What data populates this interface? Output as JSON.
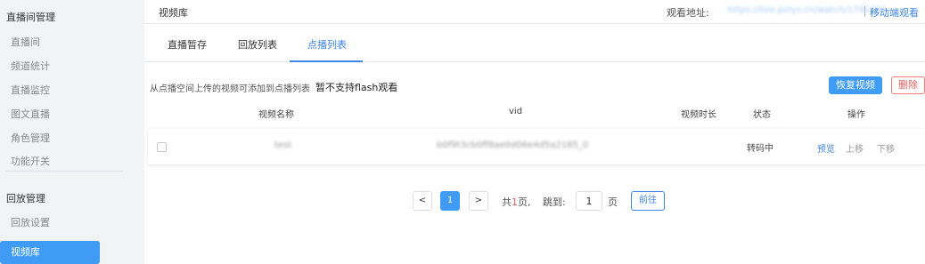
{
  "sidebar": {
    "group_live": "直播间管理",
    "items_live": [
      "直播间",
      "频道统计",
      "直播监控",
      "图文直播",
      "角色管理",
      "功能开关"
    ],
    "group_replay": "回放管理",
    "items_replay": [
      "回放设置"
    ],
    "active": "视频库"
  },
  "header": {
    "title": "视频库",
    "watch_label": "观看地址:",
    "watch_url": "https://live.polyv.cn/watch/1791661",
    "mobile_link": "移动端观看"
  },
  "tabs": [
    "直播暂存",
    "回放列表",
    "点播列表"
  ],
  "active_tab": "点播列表",
  "hint": {
    "text": "从点播空间上传的视频可添加到点播列表",
    "strong": "暂不支持flash观看"
  },
  "buttons": {
    "restore": "恢复视频",
    "delete": "删除"
  },
  "table": {
    "columns": [
      "视频名称",
      "vid",
      "视频时长",
      "状态",
      "操作"
    ],
    "rows": [
      {
        "name": "test",
        "vid": "b0f9t3cb0ff8ae0d06e4d5a2185_0",
        "duration": "",
        "status": "转码中",
        "actions": [
          "预览",
          "上移",
          "下移"
        ]
      }
    ]
  },
  "pagination": {
    "prev": "<",
    "current": "1",
    "next": ">",
    "total_prefix": "共",
    "total_pages": "1",
    "total_suffix": "页,",
    "jump_label": "跳到:",
    "jump_value": "1",
    "page_label": "页",
    "go": "前往"
  },
  "colors": {
    "accent": "#3f9bf4",
    "link": "#3f86e6",
    "danger": "#e45c5c"
  }
}
